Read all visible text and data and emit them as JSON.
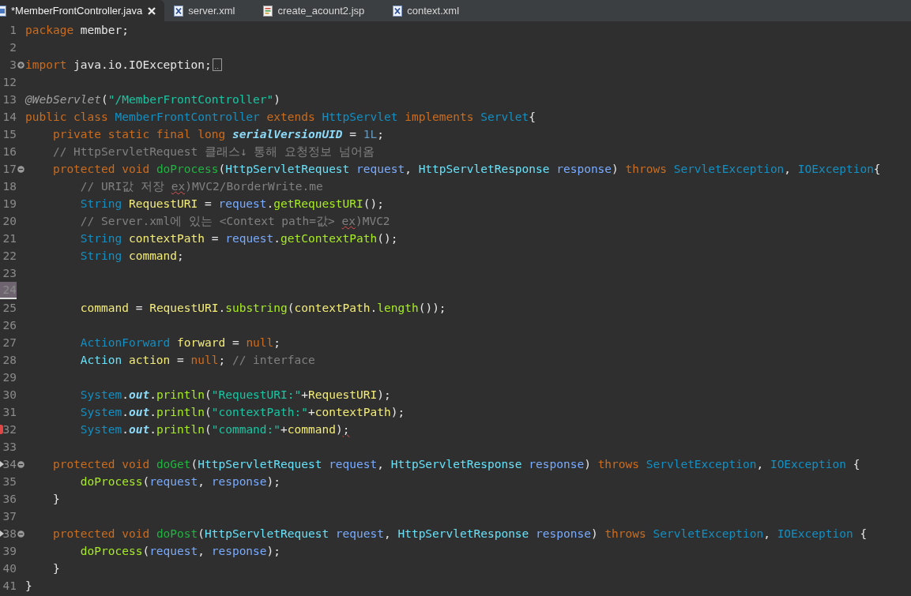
{
  "tabs": [
    {
      "label": "*MemberFrontController.java",
      "kind": "java",
      "selected": true,
      "closable": true
    },
    {
      "label": "server.xml",
      "kind": "xml",
      "selected": false,
      "closable": false
    },
    {
      "label": "create_acount2.jsp",
      "kind": "jsp",
      "selected": false,
      "closable": false
    },
    {
      "label": "context.xml",
      "kind": "xml",
      "selected": false,
      "closable": false
    }
  ],
  "lines": [
    {
      "number": "1",
      "tokens": [
        {
          "kind": "kw",
          "t": "package"
        },
        {
          "kind": "plain",
          "t": " member;"
        }
      ]
    },
    {
      "number": "2"
    },
    {
      "number": "3",
      "expanded": false,
      "folded": true,
      "tokens": [
        {
          "kind": "kw",
          "t": "import"
        },
        {
          "kind": "plain",
          "t": " java.io.IOException;"
        }
      ]
    },
    {
      "number": "12"
    },
    {
      "number": "13",
      "tokens": [
        {
          "kind": "ann",
          "t": "@WebServlet"
        },
        {
          "kind": "plain",
          "t": "("
        },
        {
          "kind": "str",
          "t": "\"/MemberFrontController\""
        },
        {
          "kind": "plain",
          "t": ")"
        }
      ]
    },
    {
      "number": "14",
      "tokens": [
        {
          "kind": "kw",
          "t": "public class "
        },
        {
          "kind": "type",
          "t": "MemberFrontController"
        },
        {
          "kind": "kw",
          "t": " extends "
        },
        {
          "kind": "type",
          "t": "HttpServlet"
        },
        {
          "kind": "kw",
          "t": " implements "
        },
        {
          "kind": "type",
          "t": "Servlet"
        },
        {
          "kind": "plain",
          "t": "{"
        }
      ]
    },
    {
      "number": "15",
      "tokens": [
        {
          "kind": "kw",
          "t": "    private static final long "
        },
        {
          "kind": "field",
          "t": "serialVersionUID"
        },
        {
          "kind": "plain",
          "t": " = "
        },
        {
          "kind": "num",
          "t": "1L"
        },
        {
          "kind": "plain",
          "t": ";"
        }
      ]
    },
    {
      "number": "16",
      "tokens": [
        {
          "kind": "comment",
          "t": "    // HttpServletRequest 클래스↓ 통해 요청정보 넘어옴"
        }
      ]
    },
    {
      "number": "17",
      "expanded": true,
      "tokens": [
        {
          "kind": "kw",
          "t": "    protected void "
        },
        {
          "kind": "decl",
          "t": "doProcess"
        },
        {
          "kind": "plain",
          "t": "("
        },
        {
          "kind": "cls",
          "t": "HttpServletRequest"
        },
        {
          "kind": "param",
          "t": " request"
        },
        {
          "kind": "plain",
          "t": ", "
        },
        {
          "kind": "cls",
          "t": "HttpServletResponse"
        },
        {
          "kind": "param",
          "t": " response"
        },
        {
          "kind": "plain",
          "t": ") "
        },
        {
          "kind": "kw",
          "t": "throws "
        },
        {
          "kind": "type",
          "t": "ServletException"
        },
        {
          "kind": "plain",
          "t": ", "
        },
        {
          "kind": "type",
          "t": "IOException"
        },
        {
          "kind": "plain",
          "t": "{"
        }
      ]
    },
    {
      "number": "18",
      "tokens": [
        {
          "kind": "comment",
          "t": "        // URI값 저장 "
        },
        {
          "kind": "comment",
          "t": "ex",
          "warn": true
        },
        {
          "kind": "comment",
          "t": ")MVC2/BorderWrite.me"
        }
      ]
    },
    {
      "number": "19",
      "tokens": [
        {
          "kind": "type",
          "t": "        String"
        },
        {
          "kind": "local",
          "t": " RequestURI"
        },
        {
          "kind": "plain",
          "t": " = "
        },
        {
          "kind": "param",
          "t": "request"
        },
        {
          "kind": "plain",
          "t": "."
        },
        {
          "kind": "method",
          "t": "getRequestURI"
        },
        {
          "kind": "plain",
          "t": "();"
        }
      ]
    },
    {
      "number": "20",
      "tokens": [
        {
          "kind": "comment",
          "t": "        // Server.xml에 있는 <Context path=값> "
        },
        {
          "kind": "comment",
          "t": "ex",
          "warn": true
        },
        {
          "kind": "comment",
          "t": ")MVC2"
        }
      ]
    },
    {
      "number": "21",
      "tokens": [
        {
          "kind": "type",
          "t": "        String"
        },
        {
          "kind": "local",
          "t": " contextPath"
        },
        {
          "kind": "plain",
          "t": " = "
        },
        {
          "kind": "param",
          "t": "request"
        },
        {
          "kind": "plain",
          "t": "."
        },
        {
          "kind": "method",
          "t": "getContextPath"
        },
        {
          "kind": "plain",
          "t": "();"
        }
      ]
    },
    {
      "number": "22",
      "tokens": [
        {
          "kind": "type",
          "t": "        String"
        },
        {
          "kind": "local",
          "t": " command"
        },
        {
          "kind": "plain",
          "t": ";"
        }
      ]
    },
    {
      "number": "23"
    },
    {
      "number": "24",
      "current": true
    },
    {
      "number": "25",
      "tokens": [
        {
          "kind": "local",
          "t": "        command"
        },
        {
          "kind": "plain",
          "t": " = "
        },
        {
          "kind": "local",
          "t": "RequestURI"
        },
        {
          "kind": "plain",
          "t": "."
        },
        {
          "kind": "method",
          "t": "substring"
        },
        {
          "kind": "plain",
          "t": "("
        },
        {
          "kind": "local",
          "t": "contextPath"
        },
        {
          "kind": "plain",
          "t": "."
        },
        {
          "kind": "method",
          "t": "length"
        },
        {
          "kind": "plain",
          "t": "());"
        }
      ]
    },
    {
      "number": "26"
    },
    {
      "number": "27",
      "tokens": [
        {
          "kind": "type",
          "t": "        ActionForward"
        },
        {
          "kind": "local",
          "t": " forward"
        },
        {
          "kind": "plain",
          "t": " = "
        },
        {
          "kind": "kw",
          "t": "null"
        },
        {
          "kind": "plain",
          "t": ";"
        }
      ]
    },
    {
      "number": "28",
      "tokens": [
        {
          "kind": "cls",
          "t": "        Action"
        },
        {
          "kind": "local",
          "t": " action"
        },
        {
          "kind": "plain",
          "t": " = "
        },
        {
          "kind": "kw",
          "t": "null"
        },
        {
          "kind": "plain",
          "t": "; "
        },
        {
          "kind": "comment",
          "t": "// interface"
        }
      ]
    },
    {
      "number": "29"
    },
    {
      "number": "30",
      "tokens": [
        {
          "kind": "type",
          "t": "        System"
        },
        {
          "kind": "plain",
          "t": "."
        },
        {
          "kind": "field",
          "t": "out"
        },
        {
          "kind": "plain",
          "t": "."
        },
        {
          "kind": "method",
          "t": "println"
        },
        {
          "kind": "plain",
          "t": "("
        },
        {
          "kind": "str",
          "t": "\"RequestURI:\""
        },
        {
          "kind": "plain",
          "t": "+"
        },
        {
          "kind": "local",
          "t": "RequestURI"
        },
        {
          "kind": "plain",
          "t": ");"
        }
      ]
    },
    {
      "number": "31",
      "tokens": [
        {
          "kind": "type",
          "t": "        System"
        },
        {
          "kind": "plain",
          "t": "."
        },
        {
          "kind": "field",
          "t": "out"
        },
        {
          "kind": "plain",
          "t": "."
        },
        {
          "kind": "method",
          "t": "println"
        },
        {
          "kind": "plain",
          "t": "("
        },
        {
          "kind": "str",
          "t": "\"contextPath:\""
        },
        {
          "kind": "plain",
          "t": "+"
        },
        {
          "kind": "local",
          "t": "contextPath"
        },
        {
          "kind": "plain",
          "t": ");"
        }
      ]
    },
    {
      "number": "32",
      "error": true,
      "tokens": [
        {
          "kind": "type",
          "t": "        System"
        },
        {
          "kind": "plain",
          "t": "."
        },
        {
          "kind": "field",
          "t": "out"
        },
        {
          "kind": "plain",
          "t": "."
        },
        {
          "kind": "method",
          "t": "println"
        },
        {
          "kind": "plain",
          "t": "("
        },
        {
          "kind": "str",
          "t": "\"command:\""
        },
        {
          "kind": "plain",
          "t": "+"
        },
        {
          "kind": "local",
          "t": "command"
        },
        {
          "kind": "plain",
          "t": ")"
        },
        {
          "kind": "plain",
          "t": ";",
          "warn": true
        }
      ]
    },
    {
      "number": "33"
    },
    {
      "number": "34",
      "expanded": true,
      "override": true,
      "tokens": [
        {
          "kind": "kw",
          "t": "    protected void "
        },
        {
          "kind": "decl",
          "t": "doGet"
        },
        {
          "kind": "plain",
          "t": "("
        },
        {
          "kind": "cls",
          "t": "HttpServletRequest"
        },
        {
          "kind": "param",
          "t": " request"
        },
        {
          "kind": "plain",
          "t": ", "
        },
        {
          "kind": "cls",
          "t": "HttpServletResponse"
        },
        {
          "kind": "param",
          "t": " response"
        },
        {
          "kind": "plain",
          "t": ") "
        },
        {
          "kind": "kw",
          "t": "throws "
        },
        {
          "kind": "type",
          "t": "ServletException"
        },
        {
          "kind": "plain",
          "t": ", "
        },
        {
          "kind": "type",
          "t": "IOException"
        },
        {
          "kind": "plain",
          "t": " {"
        }
      ]
    },
    {
      "number": "35",
      "tokens": [
        {
          "kind": "method",
          "t": "        doProcess"
        },
        {
          "kind": "plain",
          "t": "("
        },
        {
          "kind": "param",
          "t": "request"
        },
        {
          "kind": "plain",
          "t": ", "
        },
        {
          "kind": "param",
          "t": "response"
        },
        {
          "kind": "plain",
          "t": ");"
        }
      ]
    },
    {
      "number": "36",
      "tokens": [
        {
          "kind": "plain",
          "t": "    }"
        }
      ]
    },
    {
      "number": "37"
    },
    {
      "number": "38",
      "expanded": true,
      "override": true,
      "tokens": [
        {
          "kind": "kw",
          "t": "    protected void "
        },
        {
          "kind": "decl",
          "t": "doPost"
        },
        {
          "kind": "plain",
          "t": "("
        },
        {
          "kind": "cls",
          "t": "HttpServletRequest"
        },
        {
          "kind": "param",
          "t": " request"
        },
        {
          "kind": "plain",
          "t": ", "
        },
        {
          "kind": "cls",
          "t": "HttpServletResponse"
        },
        {
          "kind": "param",
          "t": " response"
        },
        {
          "kind": "plain",
          "t": ") "
        },
        {
          "kind": "kw",
          "t": "throws "
        },
        {
          "kind": "type",
          "t": "ServletException"
        },
        {
          "kind": "plain",
          "t": ", "
        },
        {
          "kind": "type",
          "t": "IOException"
        },
        {
          "kind": "plain",
          "t": " {"
        }
      ]
    },
    {
      "number": "39",
      "tokens": [
        {
          "kind": "method",
          "t": "        doProcess"
        },
        {
          "kind": "plain",
          "t": "("
        },
        {
          "kind": "param",
          "t": "request"
        },
        {
          "kind": "plain",
          "t": ", "
        },
        {
          "kind": "param",
          "t": "response"
        },
        {
          "kind": "plain",
          "t": ");"
        }
      ]
    },
    {
      "number": "40",
      "tokens": [
        {
          "kind": "plain",
          "t": "    }"
        }
      ]
    },
    {
      "number": "41",
      "tokens": [
        {
          "kind": "plain",
          "t": "}"
        }
      ]
    }
  ]
}
